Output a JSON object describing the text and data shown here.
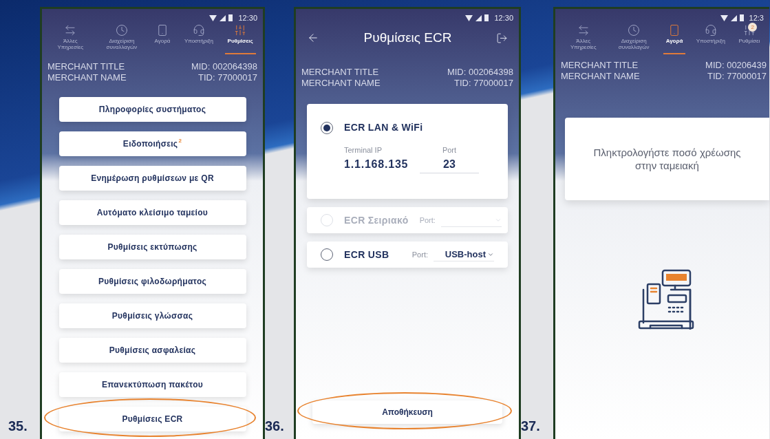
{
  "screens": [
    {
      "number": "35.",
      "kind": "menu",
      "time": "12:30",
      "tabs": [
        {
          "label": "Άλλες Υπηρεσίες",
          "selected": false
        },
        {
          "label": "Διαχείριση συναλλαγών",
          "selected": false
        },
        {
          "label": "Αγορά",
          "selected": false
        },
        {
          "label": "Υποστήριξη",
          "selected": false
        },
        {
          "label": "Ρυθμίσεις",
          "selected": true
        }
      ],
      "merchant": {
        "title": "MERCHANT TITLE",
        "name": "MERCHANT NAME",
        "mid": "MID: 002064398",
        "tid": "TID: 77000017"
      },
      "buttons": [
        {
          "label": "Πληροφορίες συστήματος",
          "highlighted": false
        },
        {
          "label": "Ειδοποιήσεις",
          "badge": "2",
          "highlighted": false
        },
        {
          "label": "Ενημέρωση ρυθμίσεων με QR",
          "highlighted": false
        },
        {
          "label": "Αυτόματο κλείσιμο ταμείου",
          "highlighted": false
        },
        {
          "label": "Ρυθμίσεις εκτύπωσης",
          "highlighted": false
        },
        {
          "label": "Ρυθμίσεις φιλοδωρήματος",
          "highlighted": false
        },
        {
          "label": "Ρυθμίσεις γλώσσας",
          "highlighted": false
        },
        {
          "label": "Ρυθμίσεις ασφαλείας",
          "highlighted": false
        },
        {
          "label": "Επανεκτύπωση πακέτου",
          "highlighted": false
        },
        {
          "label": "Ρυθμίσεις ECR",
          "highlighted": true
        }
      ]
    },
    {
      "number": "36.",
      "kind": "ecr",
      "time": "12:30",
      "title": "Ρυθμίσεις ECR",
      "merchant": {
        "title": "MERCHANT TITLE",
        "name": "MERCHANT NAME",
        "mid": "MID: 002064398",
        "tid": "TID: 77000017"
      },
      "options": [
        {
          "kind": "network",
          "label": "ECR LAN & WiFi",
          "selected": true,
          "disabled": false,
          "ip_label": "Terminal IP",
          "ip": "1.1.168.135",
          "port_label": "Port",
          "port": "23"
        },
        {
          "kind": "select",
          "label": "ECR Σειριακό",
          "selected": false,
          "disabled": true,
          "port_label": "Port:"
        },
        {
          "kind": "select",
          "label": "ECR USB",
          "selected": false,
          "disabled": false,
          "port_label": "Port:",
          "port": "USB-host"
        }
      ],
      "save": {
        "label": "Αποθήκευση",
        "highlighted": true
      }
    },
    {
      "number": "37.",
      "kind": "purchase",
      "time": "12:3",
      "tabs": [
        {
          "label": "Άλλες Υπηρεσίες",
          "selected": false
        },
        {
          "label": "Διαχείριση συναλλαγών",
          "selected": false
        },
        {
          "label": "Αγορά",
          "selected": true
        },
        {
          "label": "Υποστήριξη",
          "selected": false
        },
        {
          "label": "Ρυθμίσει",
          "selected": false,
          "badge": "2"
        }
      ],
      "merchant": {
        "title": "MERCHANT TITLE",
        "name": "MERCHANT NAME",
        "mid": "MID: 00206439",
        "tid": "TID: 77000017"
      },
      "prompt": "Πληκτρολογήστε ποσό χρέωσης στην ταμειακή"
    }
  ]
}
